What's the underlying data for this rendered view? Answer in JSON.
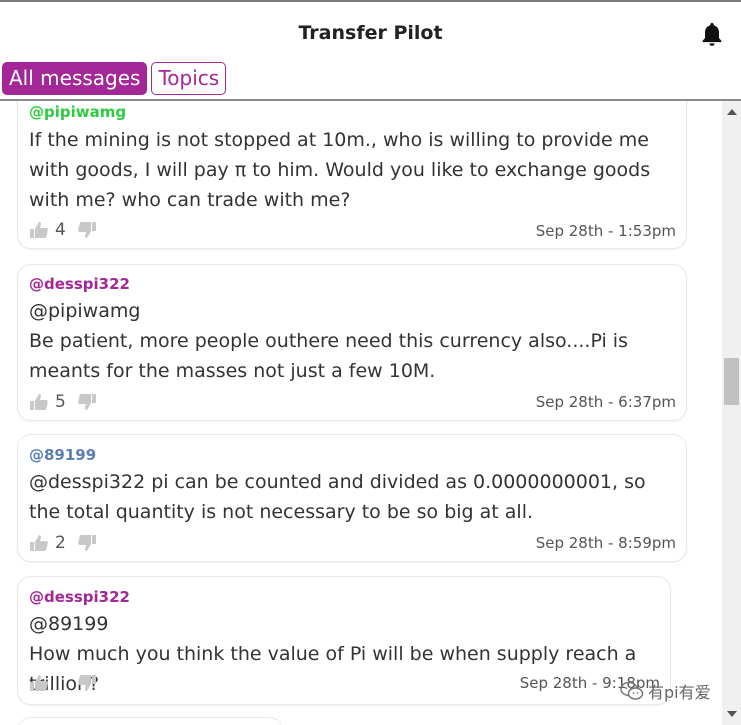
{
  "header": {
    "title": "Transfer Pilot"
  },
  "tabs": [
    {
      "label": "All messages",
      "active": true
    },
    {
      "label": "Topics",
      "active": false
    }
  ],
  "messages": [
    {
      "user": "@pipiwamg",
      "user_color": "#2ecc40",
      "body": "If the mining is not stopped at 10m., who is willing to provide me with goods, I will pay π to him. Would you like to exchange goods with me? who can trade with me?",
      "likes": "4",
      "time": "Sep 28th - 1:53pm"
    },
    {
      "user": "@desspi322",
      "user_color": "#a32796",
      "body": "@pipiwamg\nBe patient, more people outhere need this currency also....Pi is meants for the masses not just a few 10M.",
      "likes": "5",
      "time": "Sep 28th - 6:37pm"
    },
    {
      "user": "@89199",
      "user_color": "#5a7fb5",
      "body": "@desspi322 pi can be counted and divided as 0.0000000001, so the total quantity is not necessary to be so big at all.",
      "likes": "2",
      "time": "Sep 28th - 8:59pm"
    },
    {
      "user": "@desspi322",
      "user_color": "#a32796",
      "body": "@89199\nHow much you think the value of Pi will be when supply reach a trillion?",
      "likes": "",
      "time": "Sep 28th - 9:18pm"
    }
  ],
  "watermark": {
    "text": "有pi有爱"
  },
  "colors": {
    "accent": "#a32796",
    "icon_gray": "#c8c8c8"
  },
  "icons": [
    "bell-icon",
    "thumbs-up-icon",
    "thumbs-down-icon",
    "wechat-icon"
  ]
}
